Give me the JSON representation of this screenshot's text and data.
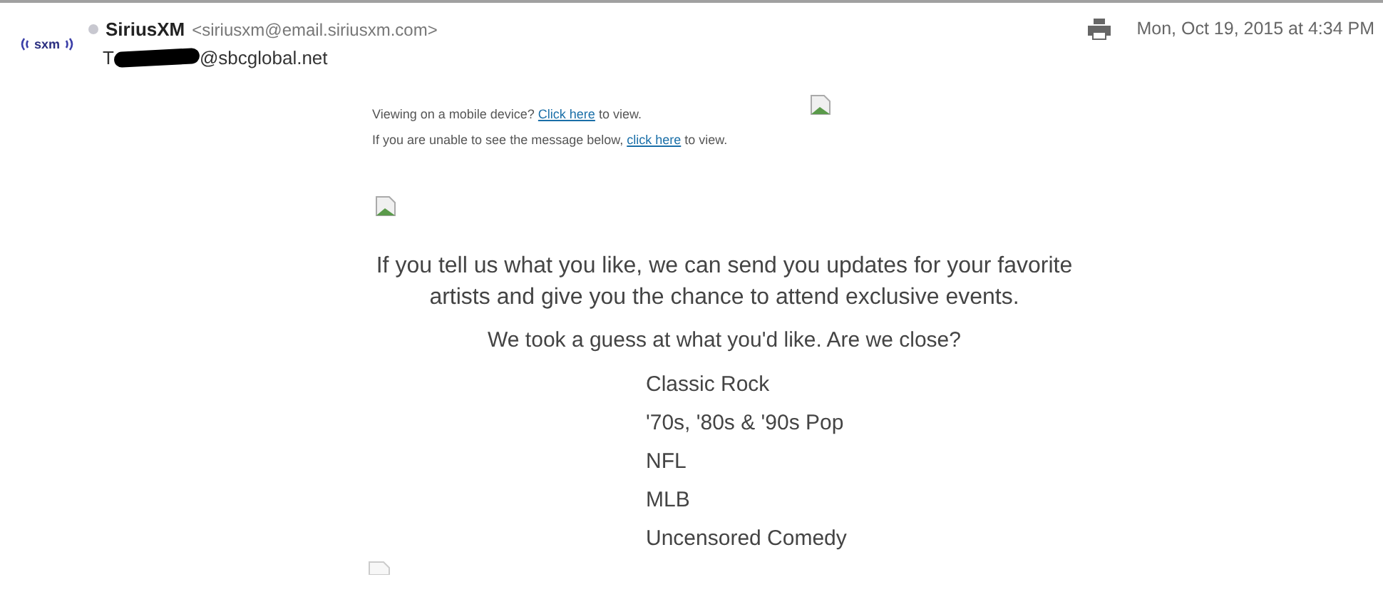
{
  "header": {
    "logo_text": "sxm",
    "sender_name": "SiriusXM",
    "sender_address": "<siriusxm@email.siriusxm.com>",
    "recipient_start": "T",
    "recipient_end": "@sbcglobal.net",
    "date": "Mon, Oct 19, 2015 at 4:34 PM"
  },
  "notices": [
    {
      "before": "Viewing on a mobile device? ",
      "link": "Click here",
      "after": " to view."
    },
    {
      "before": "If you are unable to see the message below, ",
      "link": "click here",
      "after": " to view."
    }
  ],
  "headline": "If you tell us what you like, we can send you updates for your favorite artists and give you the chance to attend exclusive events.",
  "question": "We took a guess at what you'd like. Are we close?",
  "interests": [
    "Classic Rock",
    "'70s, '80s & '90s Pop",
    "NFL",
    "MLB",
    "Uncensored Comedy"
  ]
}
